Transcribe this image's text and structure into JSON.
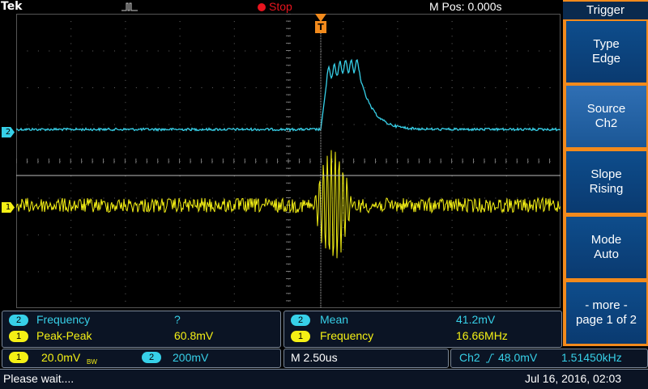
{
  "top": {
    "brand": "Tek",
    "run_state": "Stop",
    "mpos": "M Pos: 0.000s"
  },
  "channel_markers": {
    "ch1": "1",
    "ch2": "2"
  },
  "trigger_marker": "T",
  "menu": {
    "title": "Trigger",
    "buttons": [
      {
        "line1": "Type",
        "line2": "Edge"
      },
      {
        "line1": "Source",
        "line2": "Ch2"
      },
      {
        "line1": "Slope",
        "line2": "Rising"
      },
      {
        "line1": "Mode",
        "line2": "Auto"
      },
      {
        "line1": "- more -",
        "line2": "page 1 of 2"
      }
    ]
  },
  "measurements": {
    "left": [
      {
        "ch": "2",
        "name": "Frequency",
        "value": "?"
      },
      {
        "ch": "1",
        "name": "Peak-Peak",
        "value": "60.8mV"
      }
    ],
    "right": [
      {
        "ch": "2",
        "name": "Mean",
        "value": "41.2mV"
      },
      {
        "ch": "1",
        "name": "Frequency",
        "value": "16.66MHz"
      }
    ]
  },
  "vertical": {
    "ch1": {
      "badge": "1",
      "scale": "20.0mV",
      "bw": "BW"
    },
    "ch2": {
      "badge": "2",
      "scale": "200mV"
    }
  },
  "horizontal": {
    "scale": "M 2.50us"
  },
  "trigger_readout": {
    "source": "Ch2",
    "level": "48.0mV",
    "freq": "1.51450kHz"
  },
  "status": {
    "message": "Please wait....",
    "datetime": "Jul 16, 2016, 02:03"
  },
  "colors": {
    "ch1": "#f4f015",
    "ch2": "#37d0e8",
    "menu_accent": "#f28a1c",
    "stop": "#e8141e"
  }
}
